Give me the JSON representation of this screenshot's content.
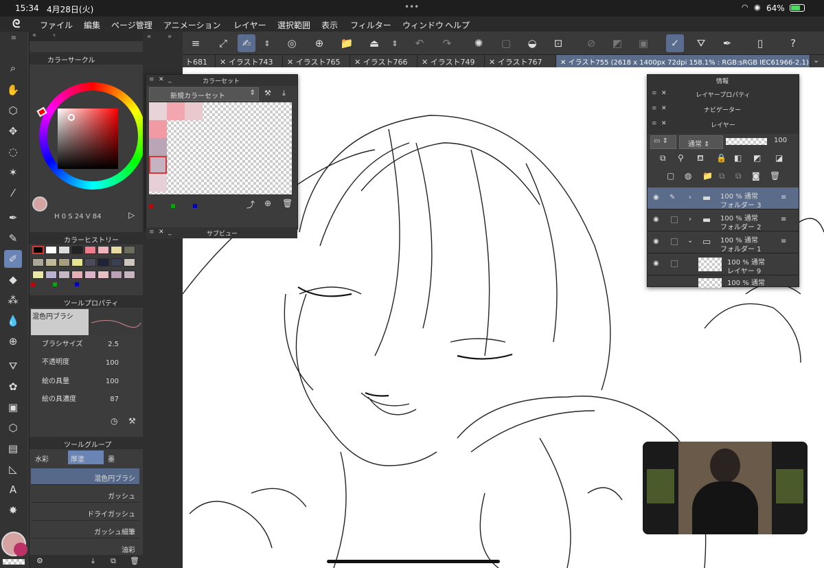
{
  "status": {
    "time": "15:34",
    "date": "4月28日(火)",
    "battery": "64%",
    "dots": "•••"
  },
  "menu": [
    "ファイル",
    "編集",
    "ページ管理",
    "アニメーション",
    "レイヤー",
    "選択範囲",
    "表示",
    "フィルター",
    "ウィンドウ",
    "ヘルプ"
  ],
  "tabs": [
    "ト681",
    "イラスト743",
    "イラスト765",
    "イラスト766",
    "イラスト749",
    "イラスト767",
    "イラスト755 (2618 x 1400px 72dpi 158.1% : RGB:sRGB IEC61966-2.1)"
  ],
  "color_circle": {
    "title": "カラーサークル",
    "h_label": "H",
    "h": "0",
    "s_label": "S",
    "s": "24",
    "v_label": "V",
    "v": "84",
    "current_color": "#d6a3a3"
  },
  "color_history": {
    "title": "カラーヒストリー",
    "colors": [
      "#000000",
      "#ffffff",
      "#dddddd",
      "#222222",
      "#f07d8e",
      "#eeb3bc",
      "#e7dba2",
      "#6d6d5f",
      "#aaa998",
      "#c0b89a",
      "#a59f80",
      "#e5e591",
      "#4b4b5a",
      "#1e2435",
      "#3b3f52",
      "#cdc6bd",
      "#e8e8a5",
      "#b9b1cf",
      "#c5b6c5",
      "#e4aeb6",
      "#d9b5c7",
      "#e6c0c4",
      "#b8a2b4",
      "#c8b4c0"
    ]
  },
  "tool_property": {
    "title": "ツールプロパティ",
    "brush_name": "混色円ブラシ",
    "props": [
      {
        "label": "ブラシサイズ",
        "value": "2.5"
      },
      {
        "label": "不透明度",
        "value": "100"
      },
      {
        "label": "絵の具量",
        "value": "100"
      },
      {
        "label": "絵の具濃度",
        "value": "87"
      }
    ]
  },
  "tool_group": {
    "title": "ツールグループ",
    "tabs": [
      "水彩",
      "厚塗",
      "墨"
    ],
    "brushes": [
      "混色円ブラシ",
      "ガッシュ",
      "ドライガッシュ",
      "ガッシュ細筆",
      "油彩"
    ]
  },
  "color_set": {
    "title": "カラーセット",
    "set_name": "新規カラーセット",
    "sub_title": "サブビュー",
    "swatches": [
      "#e8d4d8",
      "#f2a6b0",
      "#e9c9cd",
      "#f19aa4",
      "#b9a5b5",
      "#c3b3c3",
      "#e6cfd6"
    ]
  },
  "right_panel": {
    "info": "情報",
    "layer_prop": "レイヤープロパティ",
    "navigator": "ナビゲーター",
    "layer": "レイヤー",
    "blend": "通常",
    "opacity": "100"
  },
  "layers": [
    {
      "pct": "100 %",
      "mode": "通常",
      "name": "フォルダー 3",
      "selected": true
    },
    {
      "pct": "100 %",
      "mode": "通常",
      "name": "フォルダー 2",
      "selected": false
    },
    {
      "pct": "100 %",
      "mode": "通常",
      "name": "フォルダー 1",
      "selected": false
    },
    {
      "pct": "100 %",
      "mode": "通常",
      "name": "レイヤー 9",
      "selected": false
    },
    {
      "pct": "100 %",
      "mode": "通常",
      "name": "",
      "selected": false
    }
  ]
}
